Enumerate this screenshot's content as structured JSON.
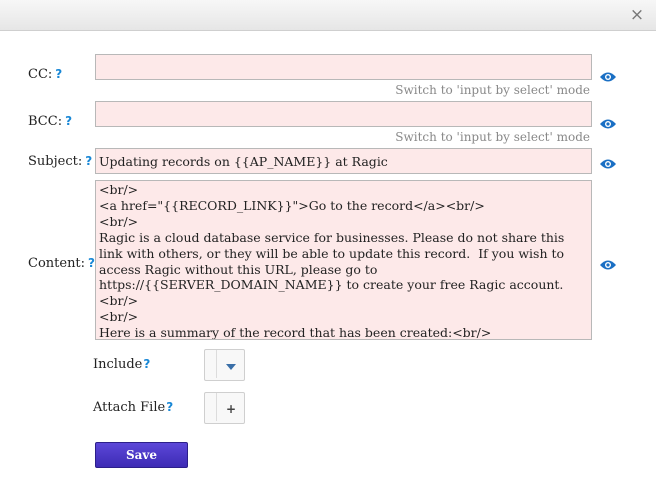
{
  "window": {
    "close_label": "×"
  },
  "help_mark": "?",
  "cc": {
    "label": "CC:",
    "value": "",
    "switch_label": "Switch to 'input by select' mode"
  },
  "bcc": {
    "label": "BCC:",
    "value": "",
    "switch_label": "Switch to 'input by select' mode"
  },
  "subject": {
    "label": "Subject:",
    "value": "Updating records on {{AP_NAME}} at Ragic"
  },
  "content": {
    "label": "Content:",
    "value": "<br/>\n<a href=\"{{RECORD_LINK}}\">Go to the record</a><br/>\n<br/>\nRagic is a cloud database service for businesses. Please do not share this link with others, or they will be able to update this record.  If you wish to access Ragic without this URL, please go to https://{{SERVER_DOMAIN_NAME}} to create your free Ragic account.<br/>\n<br/>\nHere is a summary of the record that has been created:<br/>\n<br/>\n{{RECORD_SUMMARY}}"
  },
  "include": {
    "label": "Include",
    "icon": "chevron-down-icon"
  },
  "attach": {
    "label": "Attach File",
    "icon_glyph": "+"
  },
  "save_label": "Save",
  "colors": {
    "field_bg": "#fde9e9",
    "accent": "#1a88d6",
    "button": "#4a37c8"
  }
}
